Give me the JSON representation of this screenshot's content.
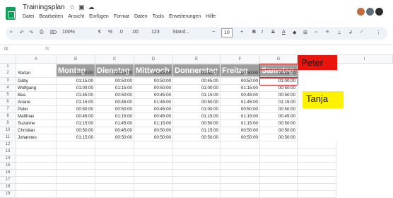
{
  "doc_title": "Trainingsplan",
  "menu": [
    "Datei",
    "Bearbeiten",
    "Ansicht",
    "Einfügen",
    "Format",
    "Daten",
    "Tools",
    "Erweiterungen",
    "Hilfe"
  ],
  "toolbar": {
    "zoom": "100%",
    "euro": "€",
    "percent": "%",
    "dec_less": ".0",
    "dec_more": ".00",
    "format123": "123",
    "font": "Stand...",
    "font_size": "10",
    "bold": "B",
    "italic": "I",
    "strike": "S",
    "text_color": "A"
  },
  "name_box": "I3",
  "fx": "fx",
  "columns": [
    "A",
    "B",
    "C",
    "D",
    "E",
    "F",
    "G",
    "H",
    "I"
  ],
  "rows": [
    "1",
    "2",
    "3",
    "4",
    "5",
    "6",
    "7",
    "8",
    "9",
    "10",
    "11",
    "12",
    "13",
    "14",
    "15",
    "16",
    "17",
    "18",
    "19"
  ],
  "headers": [
    "Montag",
    "Dienstag",
    "Mittwoch",
    "Donnerstag",
    "Freitag",
    "Samstag"
  ],
  "table": [
    {
      "name": "Stefan",
      "values": [
        "01:00:00",
        "01:15:00",
        "01:45:00",
        "00:50:00",
        "00:50:00",
        "00:45:00"
      ]
    },
    {
      "name": "Gaby",
      "values": [
        "01:15:00",
        "00:50:00",
        "00:50:00",
        "00:45:00",
        "00:50:00",
        "01:00:00"
      ]
    },
    {
      "name": "Wolfgang",
      "values": [
        "01:00:00",
        "01:15:00",
        "00:50:00",
        "01:00:00",
        "01:15:00",
        "00:50:00"
      ]
    },
    {
      "name": "Bea",
      "values": [
        "01:45:00",
        "00:50:00",
        "00:45:00",
        "01:15:00",
        "00:45:00",
        "00:50:00"
      ]
    },
    {
      "name": "Ariane",
      "values": [
        "01:15:00",
        "00:45:00",
        "01:45:00",
        "00:50:00",
        "01:45:00",
        "01:15:00"
      ]
    },
    {
      "name": "Peter",
      "values": [
        "00:50:00",
        "00:50:00",
        "00:45:00",
        "01:00:00",
        "00:50:00",
        "00:50:00"
      ]
    },
    {
      "name": "Matthias",
      "values": [
        "00:45:00",
        "01:15:00",
        "00:45:00",
        "01:15:00",
        "01:15:00",
        "00:45:00"
      ]
    },
    {
      "name": "Suzanne",
      "values": [
        "01:15:00",
        "01:45:00",
        "01:15:00",
        "00:50:00",
        "01:15:00",
        "00:50:00"
      ]
    },
    {
      "name": "Christian",
      "values": [
        "00:50:00",
        "00:45:00",
        "00:50:00",
        "01:15:00",
        "00:50:00",
        "00:50:00"
      ]
    },
    {
      "name": "Johannes",
      "values": [
        "01:15:00",
        "00:50:00",
        "00:50:00",
        "00:50:00",
        "00:50:00",
        "00:50:00"
      ]
    }
  ],
  "notes": [
    {
      "text": "Peter",
      "color": "#e8140d"
    },
    {
      "text": "Tanja",
      "color": "#fff200"
    }
  ]
}
